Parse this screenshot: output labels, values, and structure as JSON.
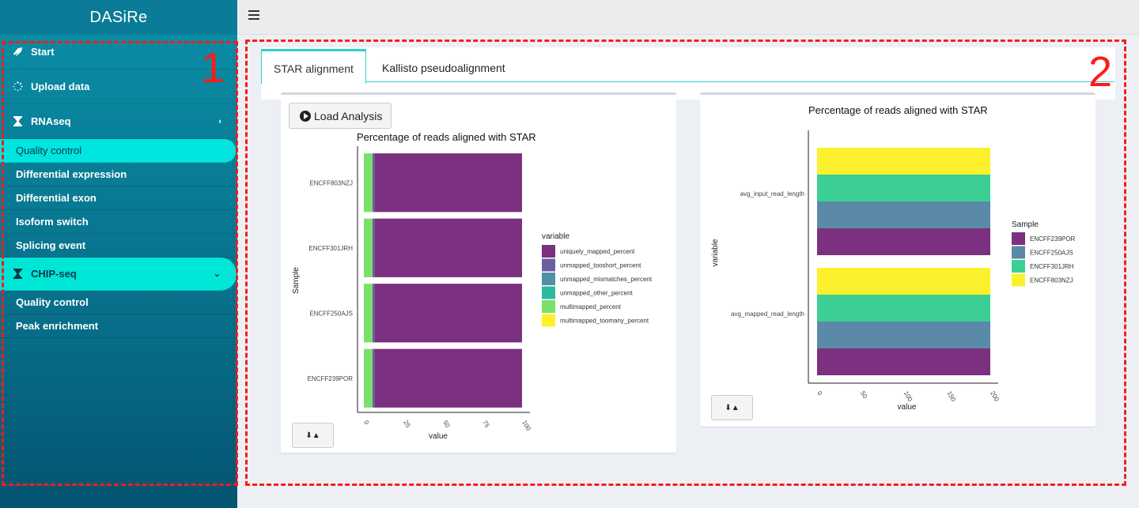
{
  "app": {
    "title": "DASiRe"
  },
  "sidebar": {
    "items": [
      {
        "label": "Start",
        "icon": "rocket-icon"
      },
      {
        "label": "Upload data",
        "icon": "spinner-icon"
      },
      {
        "label": "RNAseq",
        "icon": "hourglass-icon",
        "chevron": "left"
      },
      {
        "label": "CHIP-seq",
        "icon": "hourglass-icon",
        "chevron": "down"
      }
    ],
    "rnaseq_sub": [
      "Quality control",
      "Differential expression",
      "Differential exon",
      "Isoform switch",
      "Splicing event"
    ],
    "chipseq_sub": [
      "Quality control",
      "Peak enrichment"
    ]
  },
  "annotations": {
    "region1": "1",
    "region2": "2"
  },
  "tabs": [
    "STAR alignment",
    "Kallisto pseudoalignment"
  ],
  "buttons": {
    "load_analysis": "Load Analysis"
  },
  "colors": {
    "accent": "#00e5e0",
    "viridis": [
      "#7b3180",
      "#6b5fa0",
      "#4f8fa8",
      "#2bba9e",
      "#7be06a",
      "#fdf02c"
    ]
  },
  "chart_data": [
    {
      "type": "bar",
      "orientation": "horizontal-stacked",
      "title": "Percentage of reads aligned with STAR",
      "xlabel": "value",
      "ylabel": "Sample",
      "xlim": [
        0,
        100
      ],
      "xticks": [
        "0",
        "25",
        "50",
        "75",
        "100"
      ],
      "categories": [
        "ENCFF803NZJ",
        "ENCFF301JRH",
        "ENCFF250AJS",
        "ENCFF239POR"
      ],
      "legend_title": "variable",
      "legend_position": "right",
      "series": [
        {
          "name": "multimapped_toomany_percent",
          "color": "#fdf02c",
          "values": [
            0,
            0,
            0,
            0
          ]
        },
        {
          "name": "multimapped_percent",
          "color": "#7be06a",
          "values": [
            5.5,
            5.5,
            5.5,
            5.5
          ]
        },
        {
          "name": "unmapped_other_percent",
          "color": "#2bba9e",
          "values": [
            0,
            0,
            0,
            0
          ]
        },
        {
          "name": "unmapped_mismatches_percent",
          "color": "#4f8fa8",
          "values": [
            0,
            0,
            0,
            0
          ]
        },
        {
          "name": "unmapped_tooshort_percent",
          "color": "#6b5fa0",
          "values": [
            1.5,
            1.5,
            1.5,
            1.5
          ]
        },
        {
          "name": "uniquely_mapped_percent",
          "color": "#7b3180",
          "values": [
            93,
            93,
            93,
            93
          ]
        }
      ],
      "legend_order": [
        "uniquely_mapped_percent",
        "unmapped_tooshort_percent",
        "unmapped_mismatches_percent",
        "unmapped_other_percent",
        "multimapped_percent",
        "multimapped_toomany_percent"
      ]
    },
    {
      "type": "bar",
      "orientation": "horizontal-dodged",
      "title": "Percentage of reads aligned with STAR",
      "xlabel": "value",
      "ylabel": "variable",
      "xlim": [
        0,
        200
      ],
      "xticks": [
        "0",
        "50",
        "100",
        "150",
        "200"
      ],
      "categories": [
        "avg_input_read_length",
        "avg_mapped_read_length"
      ],
      "legend_title": "Sample",
      "legend_position": "right",
      "series": [
        {
          "name": "ENCFF239POR",
          "color": "#7b3180",
          "values": [
            200,
            200
          ]
        },
        {
          "name": "ENCFF250AJS",
          "color": "#5a8aa8",
          "values": [
            200,
            200
          ]
        },
        {
          "name": "ENCFF301JRH",
          "color": "#3bcf95",
          "values": [
            200,
            200
          ]
        },
        {
          "name": "ENCFF803NZJ",
          "color": "#fdf02c",
          "values": [
            200,
            200
          ]
        }
      ]
    }
  ]
}
